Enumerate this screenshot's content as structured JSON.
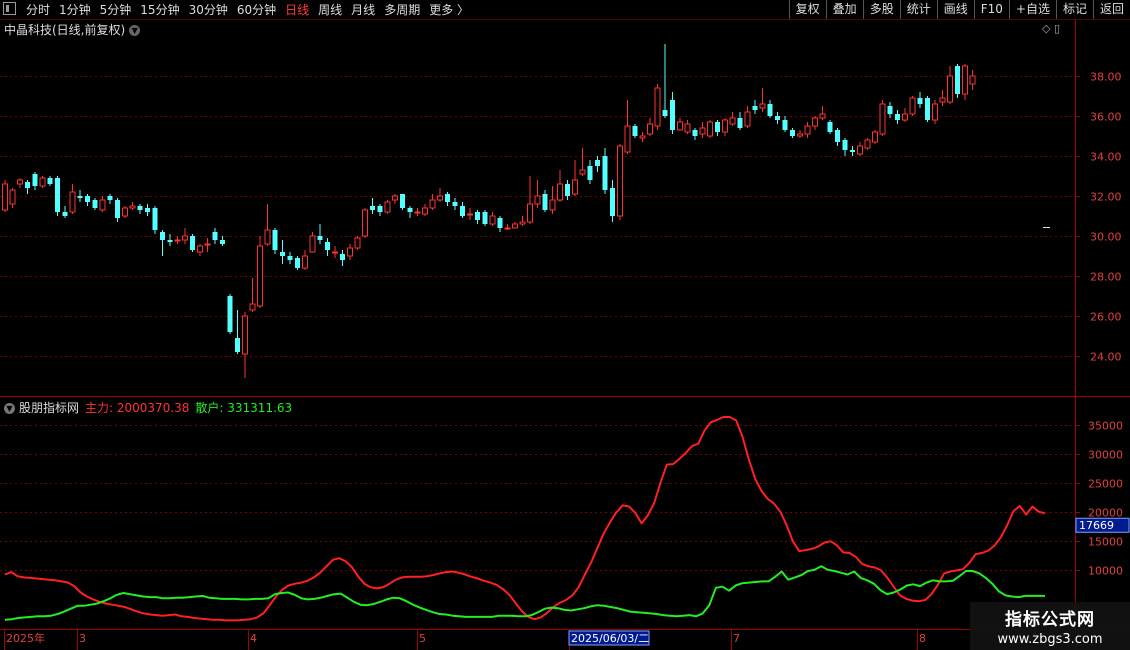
{
  "toolbar": {
    "periods": [
      {
        "label": "分时",
        "active": false
      },
      {
        "label": "1分钟",
        "active": false
      },
      {
        "label": "5分钟",
        "active": false
      },
      {
        "label": "15分钟",
        "active": false
      },
      {
        "label": "30分钟",
        "active": false
      },
      {
        "label": "60分钟",
        "active": false
      },
      {
        "label": "日线",
        "active": true
      },
      {
        "label": "周线",
        "active": false
      },
      {
        "label": "月线",
        "active": false
      },
      {
        "label": "多周期",
        "active": false
      },
      {
        "label": "更多 〉",
        "active": false
      }
    ],
    "actions": [
      "复权",
      "叠加",
      "多股",
      "统计",
      "画线",
      "F10",
      "+自选",
      "标记",
      "返回"
    ]
  },
  "stock": {
    "title": "中晶科技(日线,前复权)",
    "top_icons": "◇ ▯"
  },
  "indicator": {
    "name": "股朋指标网",
    "main_label": "主力: 2000370.38",
    "retail_label": "散户: 331311.63",
    "tag_value": "17669"
  },
  "colors": {
    "up": "#ff3232",
    "down": "#54ffff",
    "main_line": "#ff2020",
    "retail_line": "#22ee22",
    "grid": "#7a0000",
    "axis_text": "#e04040"
  },
  "x_axis": {
    "labels": [
      "2025年",
      "3",
      "4",
      "5",
      "2025/06/03/二",
      "7",
      "8"
    ],
    "highlight": "2025/06/03/二"
  },
  "watermark": {
    "line1": "指标公式网",
    "line2": "www.zbgs3.com"
  },
  "chart_data": [
    {
      "type": "candlestick",
      "title": "中晶科技(日线,前复权)",
      "y_ticks": [
        24.0,
        26.0,
        28.0,
        30.0,
        32.0,
        34.0,
        36.0,
        38.0
      ],
      "ylim": [
        22.2,
        39.8
      ],
      "candles": [
        [
          31.3,
          32.6,
          32.8,
          31.2
        ],
        [
          31.6,
          32.3,
          32.4,
          31.4
        ],
        [
          32.6,
          32.8,
          32.9,
          32.4
        ],
        [
          32.7,
          32.4,
          32.8,
          32.1
        ],
        [
          33.1,
          32.5,
          33.2,
          32.3
        ],
        [
          32.5,
          32.9,
          33.0,
          32.4
        ],
        [
          32.9,
          32.6,
          33.0,
          32.5
        ],
        [
          32.9,
          31.2,
          33.0,
          31.0
        ],
        [
          31.2,
          31.0,
          31.5,
          30.9
        ],
        [
          31.2,
          32.2,
          32.6,
          31.1
        ],
        [
          32.0,
          31.9,
          32.3,
          31.7
        ],
        [
          32.0,
          31.7,
          32.1,
          31.5
        ],
        [
          31.8,
          31.4,
          31.9,
          31.3
        ],
        [
          31.3,
          31.8,
          32.0,
          31.2
        ],
        [
          32.0,
          31.8,
          32.1,
          31.6
        ],
        [
          31.8,
          30.9,
          31.9,
          30.7
        ],
        [
          31.0,
          31.4,
          31.5,
          30.9
        ],
        [
          31.4,
          31.5,
          31.7,
          31.3
        ],
        [
          31.5,
          31.3,
          31.6,
          31.1
        ],
        [
          31.4,
          31.2,
          31.6,
          31.0
        ],
        [
          31.4,
          30.3,
          31.5,
          30.1
        ],
        [
          30.2,
          29.8,
          30.3,
          29.0
        ],
        [
          29.8,
          29.7,
          30.1,
          29.5
        ],
        [
          29.8,
          29.8,
          30.0,
          29.6
        ],
        [
          29.8,
          30.0,
          30.4,
          29.6
        ],
        [
          30.0,
          29.3,
          30.1,
          29.2
        ],
        [
          29.2,
          29.5,
          29.6,
          29.0
        ],
        [
          29.6,
          29.6,
          29.9,
          29.2
        ],
        [
          30.2,
          29.8,
          30.4,
          29.6
        ],
        [
          29.8,
          29.6,
          30.0,
          29.5
        ],
        [
          27.0,
          25.2,
          27.1,
          25.1
        ],
        [
          24.9,
          24.2,
          26.3,
          24.1
        ],
        [
          24.1,
          26.0,
          26.2,
          22.9
        ],
        [
          26.3,
          26.6,
          27.9,
          26.2
        ],
        [
          26.5,
          29.5,
          30.0,
          26.4
        ],
        [
          29.6,
          30.3,
          31.6,
          29.5
        ],
        [
          30.3,
          29.3,
          30.4,
          29.1
        ],
        [
          29.2,
          29.0,
          29.8,
          28.6
        ],
        [
          29.0,
          28.8,
          29.2,
          28.6
        ],
        [
          28.9,
          28.4,
          29.0,
          28.3
        ],
        [
          28.4,
          29.0,
          29.3,
          28.3
        ],
        [
          29.2,
          30.0,
          30.2,
          29.2
        ],
        [
          30.0,
          29.8,
          30.6,
          29.6
        ],
        [
          29.7,
          29.3,
          29.9,
          29.0
        ],
        [
          29.2,
          29.2,
          29.5,
          28.9
        ],
        [
          29.1,
          28.8,
          29.3,
          28.5
        ],
        [
          29.0,
          29.4,
          29.6,
          28.8
        ],
        [
          29.4,
          29.9,
          30.0,
          29.3
        ],
        [
          30.0,
          31.3,
          31.4,
          29.9
        ],
        [
          31.5,
          31.3,
          31.9,
          31.1
        ],
        [
          31.5,
          31.2,
          31.6,
          31.0
        ],
        [
          31.2,
          31.7,
          31.8,
          31.1
        ],
        [
          31.8,
          32.0,
          32.1,
          31.6
        ],
        [
          32.1,
          31.4,
          32.1,
          31.3
        ],
        [
          31.4,
          31.2,
          31.5,
          30.9
        ],
        [
          31.2,
          31.2,
          31.4,
          31.0
        ],
        [
          31.1,
          31.4,
          31.6,
          31.0
        ],
        [
          31.4,
          31.8,
          32.1,
          31.3
        ],
        [
          31.8,
          32.0,
          32.4,
          31.7
        ],
        [
          32.1,
          31.7,
          32.2,
          31.5
        ],
        [
          31.7,
          31.5,
          31.9,
          31.3
        ],
        [
          31.5,
          31.0,
          31.7,
          30.9
        ],
        [
          31.1,
          31.1,
          31.4,
          30.8
        ],
        [
          31.2,
          30.8,
          31.3,
          30.6
        ],
        [
          31.2,
          30.6,
          31.3,
          30.5
        ],
        [
          30.6,
          31.0,
          31.2,
          30.5
        ],
        [
          30.9,
          30.4,
          31.0,
          30.2
        ],
        [
          30.4,
          30.4,
          30.6,
          30.3
        ],
        [
          30.4,
          30.6,
          30.7,
          30.4
        ],
        [
          30.6,
          30.7,
          31.0,
          30.5
        ],
        [
          30.7,
          31.6,
          33.0,
          30.6
        ],
        [
          31.6,
          32.0,
          32.8,
          31.4
        ],
        [
          32.1,
          31.3,
          32.3,
          31.2
        ],
        [
          31.3,
          31.8,
          32.5,
          31.1
        ],
        [
          31.8,
          32.6,
          33.3,
          31.7
        ],
        [
          32.6,
          32.0,
          32.8,
          31.8
        ],
        [
          32.1,
          32.8,
          33.8,
          32.0
        ],
        [
          33.1,
          33.3,
          34.4,
          33.0
        ],
        [
          33.5,
          32.8,
          33.8,
          32.6
        ],
        [
          33.8,
          33.5,
          34.0,
          33.2
        ],
        [
          34.0,
          32.3,
          34.4,
          32.1
        ],
        [
          32.4,
          31.0,
          32.8,
          30.7
        ],
        [
          31.0,
          34.5,
          34.6,
          30.8
        ],
        [
          34.2,
          35.5,
          36.8,
          34.1
        ],
        [
          35.5,
          35.0,
          35.6,
          34.9
        ],
        [
          34.9,
          35.0,
          35.2,
          34.7
        ],
        [
          35.1,
          35.6,
          35.9,
          35.0
        ],
        [
          35.5,
          37.4,
          37.6,
          35.3
        ],
        [
          36.3,
          36.0,
          39.6,
          35.9
        ],
        [
          36.8,
          35.3,
          37.2,
          35.1
        ],
        [
          35.3,
          35.7,
          35.9,
          35.3
        ],
        [
          35.2,
          35.6,
          35.8,
          35.1
        ],
        [
          35.3,
          35.0,
          35.4,
          34.8
        ],
        [
          35.1,
          35.4,
          35.7,
          34.9
        ],
        [
          35.0,
          35.7,
          35.8,
          34.9
        ],
        [
          35.7,
          35.2,
          35.8,
          35.0
        ],
        [
          35.2,
          35.8,
          35.9,
          35.0
        ],
        [
          35.6,
          35.9,
          36.2,
          35.5
        ],
        [
          35.9,
          35.4,
          36.2,
          35.3
        ],
        [
          35.5,
          36.2,
          36.5,
          35.4
        ],
        [
          36.5,
          36.3,
          36.8,
          36.1
        ],
        [
          36.4,
          36.6,
          37.4,
          36.2
        ],
        [
          36.6,
          36.0,
          36.8,
          35.9
        ],
        [
          36.0,
          35.8,
          36.2,
          35.6
        ],
        [
          35.8,
          35.3,
          36.0,
          35.2
        ],
        [
          35.3,
          35.0,
          35.4,
          34.9
        ],
        [
          35.0,
          35.1,
          35.3,
          34.9
        ],
        [
          35.1,
          35.5,
          35.7,
          34.9
        ],
        [
          35.5,
          35.9,
          36.0,
          35.3
        ],
        [
          35.9,
          36.1,
          36.5,
          35.8
        ],
        [
          35.7,
          35.2,
          35.8,
          35.1
        ],
        [
          35.3,
          34.7,
          35.4,
          34.5
        ],
        [
          34.8,
          34.3,
          34.9,
          34.0
        ],
        [
          34.3,
          34.2,
          34.5,
          34.0
        ],
        [
          34.1,
          34.5,
          34.7,
          34.0
        ],
        [
          34.4,
          34.8,
          34.9,
          34.3
        ],
        [
          34.7,
          35.2,
          35.3,
          34.6
        ],
        [
          35.1,
          36.6,
          36.8,
          35.0
        ],
        [
          36.5,
          36.1,
          36.7,
          35.9
        ],
        [
          36.1,
          35.8,
          36.3,
          35.6
        ],
        [
          35.8,
          36.1,
          36.4,
          35.7
        ],
        [
          36.1,
          36.9,
          37.0,
          36.0
        ],
        [
          36.9,
          36.6,
          37.2,
          36.4
        ],
        [
          36.9,
          35.8,
          37.0,
          35.7
        ],
        [
          35.8,
          36.6,
          36.8,
          35.6
        ],
        [
          36.7,
          36.9,
          37.3,
          36.5
        ],
        [
          36.7,
          38.0,
          38.5,
          36.6
        ],
        [
          38.5,
          37.1,
          38.6,
          36.9
        ],
        [
          37.1,
          38.5,
          38.6,
          36.8
        ],
        [
          37.6,
          38.0,
          38.3,
          37.3
        ]
      ]
    },
    {
      "type": "line",
      "title": "股朋指标网",
      "y_ticks": [
        10000,
        15000,
        20000,
        25000,
        30000,
        35000
      ],
      "series": [
        {
          "name": "主力",
          "values": [
            9200,
            9600,
            8900,
            8700,
            8600,
            8500,
            8400,
            8300,
            8200,
            8000,
            7800,
            7200,
            6100,
            5400,
            4900,
            4500,
            4200,
            4000,
            3800,
            3600,
            3200,
            2800,
            2500,
            2300,
            2200,
            2100,
            2200,
            2300,
            2000,
            1900,
            1700,
            1600,
            1500,
            1400,
            1400,
            1300,
            1300,
            1300,
            1400,
            1500,
            1800,
            2500,
            3900,
            5400,
            6600,
            7300,
            7600,
            7800,
            8100,
            8700,
            9500,
            10600,
            11700,
            12000,
            11500,
            10500,
            8900,
            7600,
            7000,
            6800,
            7000,
            7600,
            8300,
            8700,
            8800,
            8800,
            8800,
            8900,
            9100,
            9400,
            9600,
            9700,
            9500,
            9200,
            8800,
            8500,
            8100,
            7800,
            7400,
            6700,
            5700,
            4300,
            2900,
            1900,
            1500,
            1800,
            2600,
            3600,
            4300,
            4800,
            5600,
            7000,
            9200,
            11300,
            13800,
            16300,
            18200,
            19900,
            21100,
            20900,
            19800,
            18000,
            19400,
            21500,
            25000,
            28100,
            28200,
            29100,
            30100,
            31300,
            31700,
            34000,
            35400,
            35800,
            36300,
            36300,
            35700,
            32900,
            29000,
            25700,
            23600,
            22200,
            21400,
            20000,
            17700,
            14900,
            13200,
            13400,
            13600,
            14000,
            14700,
            14900,
            14200,
            13000,
            12900,
            12200,
            11000,
            10600,
            10400,
            9900,
            8600,
            7100,
            5600,
            5000,
            4700,
            4600,
            4800,
            5800,
            7400,
            9400,
            9700,
            9900,
            10100,
            11200,
            12700,
            12900,
            13300,
            14200,
            15600,
            17700,
            20100,
            21000,
            19500,
            20900,
            20000,
            19700
          ],
          "color": "#ff2020"
        },
        {
          "name": "散户",
          "values": [
            1400,
            1500,
            1700,
            1800,
            1900,
            2000,
            2000,
            2100,
            2400,
            2800,
            3300,
            3800,
            3800,
            4000,
            4200,
            4600,
            5100,
            5700,
            6000,
            5800,
            5600,
            5400,
            5300,
            5300,
            5100,
            5100,
            5200,
            5200,
            5300,
            5400,
            5500,
            5200,
            5100,
            5000,
            5000,
            5000,
            4900,
            4900,
            5000,
            5000,
            5100,
            5800,
            6000,
            6100,
            5700,
            5100,
            4900,
            5000,
            5200,
            5500,
            5800,
            5900,
            5200,
            4500,
            4000,
            3900,
            4100,
            4500,
            4900,
            5200,
            5100,
            4600,
            4000,
            3500,
            3100,
            2700,
            2400,
            2300,
            2100,
            2000,
            1900,
            1900,
            1900,
            1900,
            1900,
            2100,
            2100,
            2100,
            2000,
            2000,
            2200,
            2700,
            3300,
            3500,
            3400,
            3100,
            3000,
            3200,
            3400,
            3700,
            3900,
            3800,
            3600,
            3400,
            3100,
            2800,
            2700,
            2600,
            2500,
            2400,
            2200,
            2100,
            2000,
            2100,
            2200,
            2000,
            2500,
            3900,
            6900,
            7100,
            6400,
            7300,
            7700,
            7800,
            7900,
            8000,
            8000,
            8800,
            9700,
            8300,
            8700,
            9100,
            9800,
            10000,
            10600,
            10000,
            9800,
            9500,
            9200,
            9700,
            8600,
            8200,
            7600,
            6500,
            5800,
            6100,
            6600,
            7300,
            7500,
            7200,
            7800,
            8200,
            8000,
            8000,
            8100,
            8900,
            9800,
            9800,
            9400,
            8600,
            7600,
            6300,
            5600,
            5400,
            5300,
            5500,
            5500,
            5500,
            5500
          ],
          "color": "#22ee22"
        }
      ]
    }
  ]
}
